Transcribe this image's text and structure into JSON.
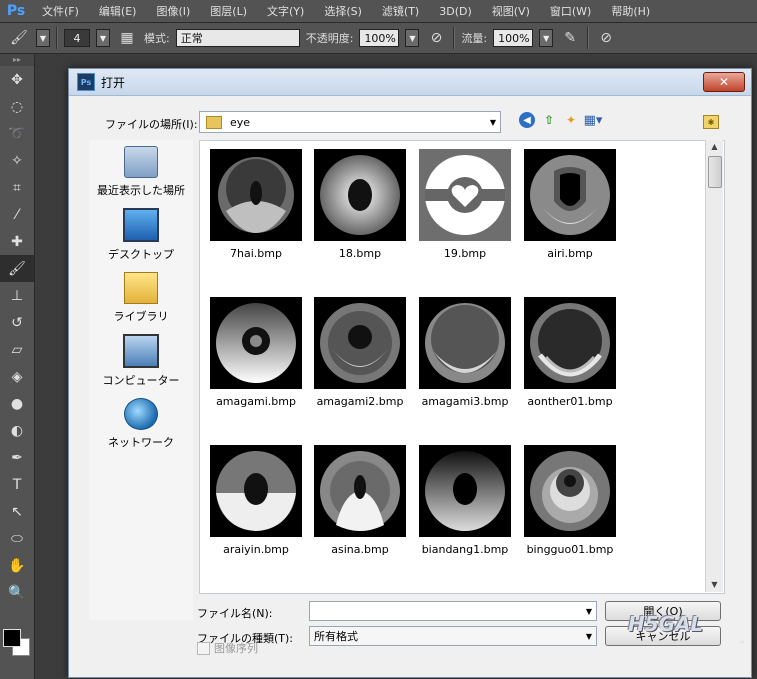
{
  "app": {
    "logo": "Ps",
    "menu": [
      "文件(F)",
      "编辑(E)",
      "图像(I)",
      "图层(L)",
      "文字(Y)",
      "选择(S)",
      "滤镜(T)",
      "3D(D)",
      "视图(V)",
      "窗口(W)",
      "帮助(H)"
    ]
  },
  "options": {
    "brush_size": "4",
    "mode_label": "模式:",
    "mode_value": "正常",
    "opacity_label": "不透明度:",
    "opacity_value": "100%",
    "flow_label": "流量:",
    "flow_value": "100%"
  },
  "dialog": {
    "title": "打开",
    "close_glyph": "✕",
    "location_label": "ファイルの場所(I):",
    "location_value": "eye",
    "places": [
      {
        "label": "最近表示した場所",
        "icon": "recent-places-icon"
      },
      {
        "label": "デスクトップ",
        "icon": "desktop-icon"
      },
      {
        "label": "ライブラリ",
        "icon": "library-icon"
      },
      {
        "label": "コンピューター",
        "icon": "computer-icon"
      },
      {
        "label": "ネットワーク",
        "icon": "network-icon"
      }
    ],
    "files": [
      {
        "name": "7hai.bmp"
      },
      {
        "name": "18.bmp"
      },
      {
        "name": "19.bmp"
      },
      {
        "name": "airi.bmp"
      },
      {
        "name": "amagami.bmp"
      },
      {
        "name": "amagami2.bmp"
      },
      {
        "name": "amagami3.bmp"
      },
      {
        "name": "aonther01.bmp"
      },
      {
        "name": "araiyin.bmp"
      },
      {
        "name": "asina.bmp"
      },
      {
        "name": "biandang1.bmp"
      },
      {
        "name": "bingguo01.bmp"
      }
    ],
    "filename_label": "ファイル名(N):",
    "filename_value": "",
    "filetype_label": "ファイルの種類(T):",
    "filetype_value": "所有格式",
    "open_button": "開く(O)",
    "cancel_button": "キャンセル",
    "image_sequence_label": "图像序列"
  },
  "watermark": {
    "text": "H5GAL",
    "tm": "™"
  }
}
